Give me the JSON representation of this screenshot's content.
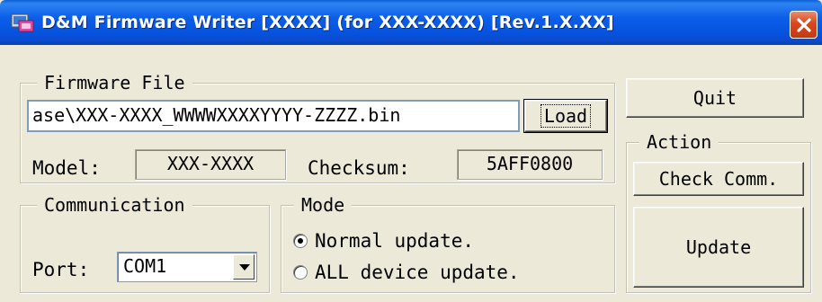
{
  "window": {
    "title": "D&M Firmware Writer [XXXX] (for XXX-XXXX) [Rev.1.X.XX]",
    "accent": "#0a5fd6",
    "close_color": "#d9471d"
  },
  "firmware_file": {
    "legend": "Firmware File",
    "path_value": "ase\\XXX-XXXX_WWWWXXXXYYYY-ZZZZ.bin",
    "load_label": "Load",
    "model_label": "Model:",
    "model_value": "XXX-XXXX",
    "checksum_label": "Checksum:",
    "checksum_value": "5AFF0800"
  },
  "communication": {
    "legend": "Communication",
    "port_label": "Port:",
    "port_value": "COM1"
  },
  "mode": {
    "legend": "Mode",
    "options": [
      {
        "label": "Normal update.",
        "selected": true
      },
      {
        "label": "ALL device update.",
        "selected": false
      }
    ]
  },
  "quit_label": "Quit",
  "action": {
    "legend": "Action",
    "check_label": "Check Comm.",
    "update_label": "Update"
  },
  "icons": {
    "app": "app-icon",
    "close": "close-icon",
    "dropdown": "chevron-down-icon"
  }
}
